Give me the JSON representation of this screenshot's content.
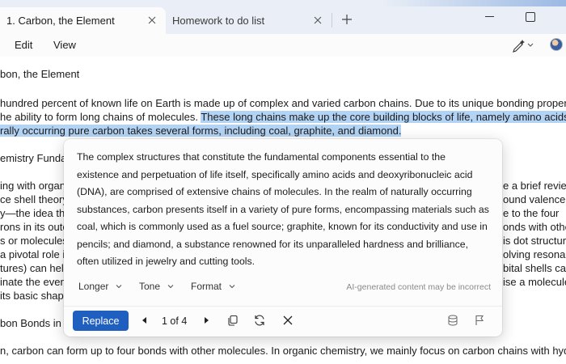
{
  "tabs": [
    {
      "label": "1. Carbon, the Element",
      "active": true
    },
    {
      "label": "Homework to do list",
      "active": false
    }
  ],
  "menu": {
    "edit": "Edit",
    "view": "View"
  },
  "document": {
    "title": "bon, the Element",
    "para1": [
      {
        "text": "hundred percent of known life on Earth is made up of complex and varied carbon chains. Due to its unique bonding properties, carbo",
        "highlight": ""
      },
      {
        "text": "he ability to form long chains of molecules. ",
        "highlight": "These long chains make up the core building blocks of life, namely amino acids and DNA."
      },
      {
        "text": "",
        "highlight": "rally occurring pure carbon takes several forms, including coal, graphite, and diamond."
      }
    ],
    "heading2": "emistry Fundan",
    "para2": [
      {
        "left": "ing with organi",
        "right": "e a brief revie"
      },
      {
        "left": "ce shell theory,",
        "right": "ound valence s"
      },
      {
        "left": "y—the idea tha",
        "right": "e to the four"
      },
      {
        "left": "rons in its outer",
        "right": "onds with other"
      },
      {
        "left": "s or molecules.",
        "right": "is dot structure"
      },
      {
        "left": "a pivotal role in",
        "right": "olving resonant"
      },
      {
        "left": "tures) can help",
        "right": "bital shells can"
      },
      {
        "left": "inate the event",
        "right": "ise a molecule"
      },
      {
        "left": "its basic shape",
        "right": ""
      }
    ],
    "heading3": "bon Bonds in C",
    "para3": [
      "n, carbon can form up to four bonds with other molecules. In organic chemistry, we mainly focus on carbon chains with hydrogen and"
    ]
  },
  "rewrite": {
    "text": "The complex structures that constitute the fundamental components essential to the existence and perpetuation of life itself, specifically amino acids and deoxyribonucleic acid (DNA), are comprised of extensive chains of molecules. In the realm of naturally occurring substances, carbon presents itself in a variety of pure forms, encompassing materials such as coal, which is commonly used as a fuel source; graphite, known for its conductivity and use in pencils; and diamond, a substance renowned for its unparalleled hardness and brilliance, often utilized in jewelry and cutting tools.",
    "options": {
      "length": "Longer",
      "tone": "Tone",
      "format": "Format"
    },
    "disclaimer": "AI-generated content may be incorrect",
    "replace_label": "Replace",
    "pager": "1 of 4"
  },
  "icons": {
    "tab_close": "close-icon",
    "new_tab": "plus-icon",
    "copilot": "pen-sparkle-icon",
    "prev": "previous-icon",
    "next": "next-icon",
    "copy": "copy-icon",
    "regenerate": "refresh-icon",
    "dismiss": "close-icon",
    "stack": "stack-icon",
    "feedback": "flag-icon"
  },
  "colors": {
    "accent": "#1f5fbf",
    "highlight": "#b3d3f5",
    "titlebar": "#eaeff7"
  }
}
